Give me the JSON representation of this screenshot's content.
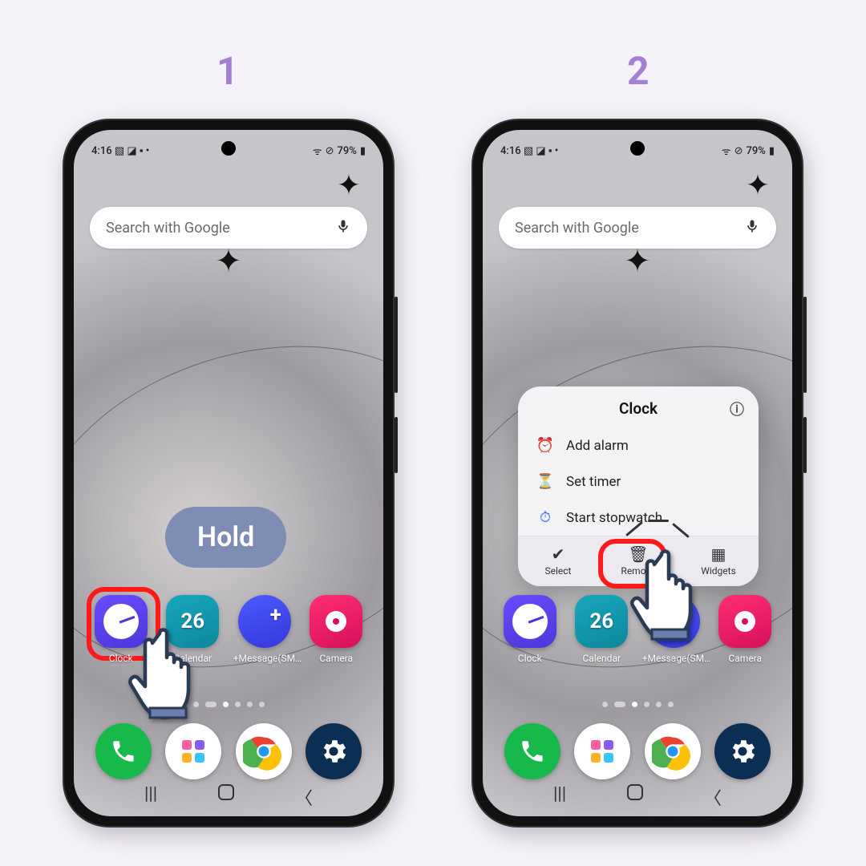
{
  "steps": {
    "one": "1",
    "two": "2"
  },
  "status": {
    "time": "4:16",
    "battery": "79%"
  },
  "search": {
    "placeholder": "Search with Google"
  },
  "hold_label": "Hold",
  "apps": {
    "clock": "Clock",
    "calendar": "Calendar",
    "calnum": "26",
    "msg": "+Message(SM…",
    "camera": "Camera"
  },
  "popup": {
    "title": "Clock",
    "add_alarm": "Add alarm",
    "set_timer": "Set timer",
    "stopwatch": "Start stopwatch",
    "select": "Select",
    "remove": "Remove",
    "widgets": "Widgets"
  }
}
